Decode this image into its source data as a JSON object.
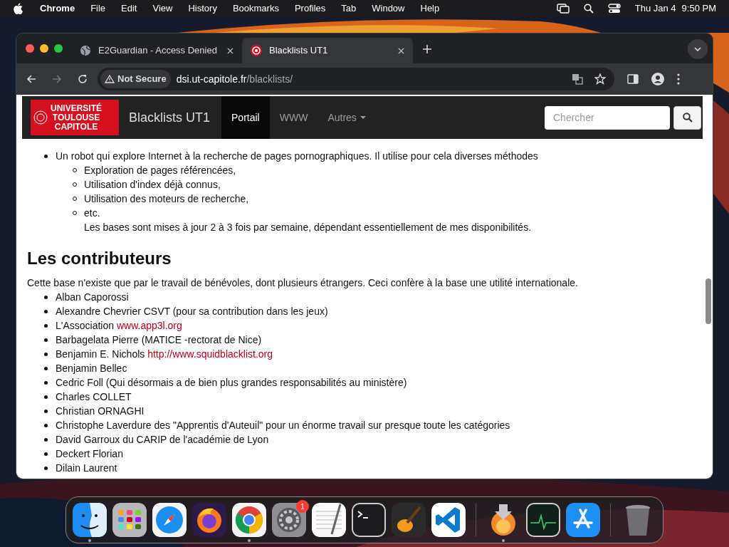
{
  "menubar": {
    "app": "Chrome",
    "items": [
      "File",
      "Edit",
      "View",
      "History",
      "Bookmarks",
      "Profiles",
      "Tab",
      "Window",
      "Help"
    ],
    "date": "Thu Jan 4",
    "time": "9:50 PM"
  },
  "tabs": [
    {
      "title": "E2Guardian - Access Denied",
      "selected": false,
      "kind": "globe"
    },
    {
      "title": "Blacklists UT1",
      "selected": true,
      "kind": "site"
    }
  ],
  "address": {
    "security": "Not Secure",
    "host": "dsi.ut-capitole.fr",
    "path": "/blacklists/"
  },
  "site": {
    "logo": [
      "UNIVERSITÉ",
      "TOULOUSE",
      "CAPITOLE"
    ],
    "brand": "Blacklists UT1",
    "nav": [
      {
        "label": "Portail",
        "selected": true,
        "kind": "link"
      },
      {
        "label": "WWW",
        "selected": false,
        "kind": "link"
      },
      {
        "label": "Autres",
        "selected": false,
        "kind": "dropdown"
      }
    ],
    "search": {
      "placeholder": "Chercher"
    }
  },
  "sources": [
    {
      "text": "Un robot qui explore Internet à la recherche de pages pornographiques. Il utilise pour cela diverses méthodes",
      "children": [
        "Exploration de pages référencées,",
        "Utilisation d'index déjà connus,",
        "Utilisation des moteurs de recherche,",
        "etc."
      ],
      "note": "Les bases sont mises à jour 2 à 3 fois par semaine, dépendant essentiellement de mes disponibilités."
    }
  ],
  "heading": "Les contributeurs",
  "intro": "Cette base n'existe que par le travail de bénévoles, dont plusieurs étrangers. Ceci confère à la base une utilité internationale.",
  "contributors": [
    {
      "text": "Alban Caporossi"
    },
    {
      "text": "Alexandre Chevrier CSVT (pour sa contribution dans les jeux)"
    },
    {
      "text": "L'Association",
      "link": "www.app3l.org"
    },
    {
      "text": "Barbagelata Pierre (MATICE -rectorat de Nice)"
    },
    {
      "text": "Benjamin E. Nichols",
      "link": "http://www.squidblacklist.org"
    },
    {
      "text": "Benjamin Bellec"
    },
    {
      "text": "Cedric Foll (Qui désormais a de bien plus grandes responsabilités au ministère)"
    },
    {
      "text": "Charles COLLET"
    },
    {
      "text": "Christian ORNAGHI"
    },
    {
      "text": "Christophe Laverdure des \"Apprentis d'Auteuil\" pour un énorme travail sur presque toute les catégories"
    },
    {
      "text": "David Garroux du CARIP de l'académie de Lyon"
    },
    {
      "text": "Deckert Florian"
    },
    {
      "text": "Dilain Laurent"
    }
  ],
  "dock": [
    {
      "kind": "finder",
      "running": true
    },
    {
      "kind": "launchpad",
      "running": false
    },
    {
      "kind": "safari",
      "running": false
    },
    {
      "kind": "firefox",
      "running": false
    },
    {
      "kind": "chrome",
      "running": true
    },
    {
      "kind": "settings",
      "running": false,
      "badge": "1"
    },
    {
      "kind": "textedit",
      "running": false
    },
    {
      "kind": "terminal",
      "running": false
    },
    {
      "kind": "garageband",
      "running": false
    },
    {
      "kind": "vscode",
      "running": false
    },
    {
      "kind": "separator"
    },
    {
      "kind": "installer",
      "running": true
    },
    {
      "kind": "monitor",
      "running": false
    },
    {
      "kind": "appstore",
      "running": false
    },
    {
      "kind": "separator"
    },
    {
      "kind": "trash",
      "running": false
    }
  ]
}
